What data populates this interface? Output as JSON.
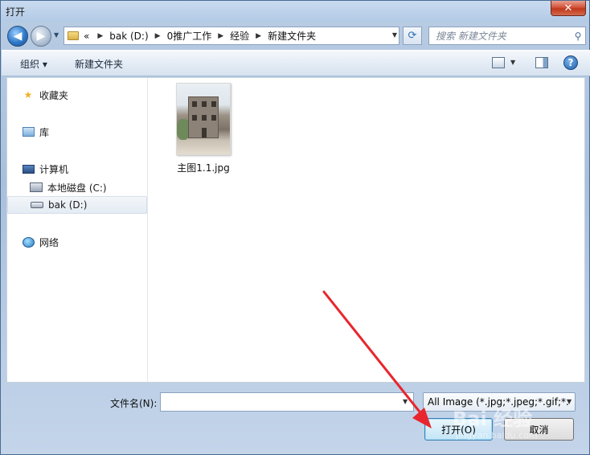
{
  "window": {
    "title": "打开",
    "close_glyph": "✕"
  },
  "nav": {
    "back_glyph": "◀",
    "forward_glyph": "▶"
  },
  "address": {
    "crumbs": [
      "«",
      "bak (D:)",
      "0推广工作",
      "经验",
      "新建文件夹"
    ]
  },
  "search": {
    "placeholder": "搜索 新建文件夹"
  },
  "toolbar": {
    "organize_label": "组织 ▾",
    "new_folder_label": "新建文件夹",
    "help_glyph": "?"
  },
  "sidebar": {
    "favorites": "收藏夹",
    "libraries": "库",
    "computer": "计算机",
    "drive_c": "本地磁盘 (C:)",
    "drive_d": "bak (D:)",
    "network": "网络"
  },
  "files": [
    {
      "name": "主图1.1.jpg",
      "type": "image"
    }
  ],
  "bottom": {
    "filename_label": "文件名(N):",
    "filename_value": "",
    "file_type": "All Image (*.jpg;*.jpeg;*.gif;*.",
    "open_label": "打开(O)",
    "cancel_label": "取消"
  },
  "watermark": {
    "main": "Bai 经验",
    "sub": "jingyan.baidu.com"
  },
  "colors": {
    "arrow": "#e8262d",
    "accent": "#3c7fb1"
  },
  "icons": {
    "back": "back-arrow-icon",
    "forward": "forward-arrow-icon",
    "refresh": "refresh-icon",
    "search": "search-icon",
    "help": "help-icon"
  }
}
